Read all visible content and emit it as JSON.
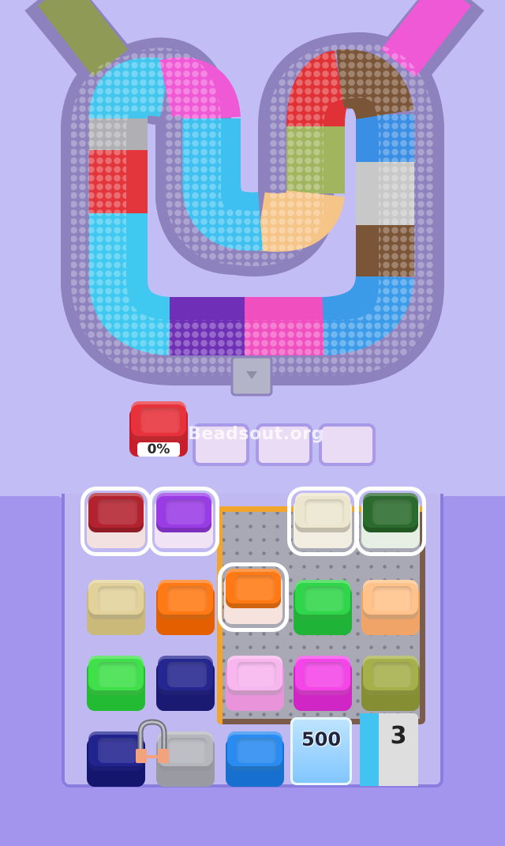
{
  "track": {
    "segment_colors": [
      "#8e9a55",
      "#43c6ee",
      "#ef59d6",
      "#b0b0b4",
      "#e2363c",
      "#3fc8f0",
      "#6f2fb6",
      "#f04fc0",
      "#3b9be9",
      "#7b5538",
      "#c8c8c8",
      "#3a8ee3",
      "#e03236",
      "#a1b45e",
      "#f5c487",
      "#3ec0f0",
      "#ef4fcb",
      "#6a7f3d"
    ],
    "exit_label": ""
  },
  "queue": {
    "slots": [
      {
        "color": "#e8323b",
        "progress": "0%"
      },
      {
        "color": null
      },
      {
        "color": null
      },
      {
        "color": null
      }
    ]
  },
  "watermark": "Beadsout.org",
  "boxes": [
    {
      "id": "red-dark",
      "color": "#b3232f",
      "selected": true
    },
    {
      "id": "purple",
      "color": "#9a3ce6",
      "selected": true
    },
    {
      "id": "cream",
      "color": "#ece6cf",
      "selected": true
    },
    {
      "id": "green-dark",
      "color": "#2b6b2d",
      "selected": true
    },
    {
      "id": "khaki",
      "color": "#e2d29a",
      "selected": false
    },
    {
      "id": "orange",
      "color": "#ff7a14",
      "selected": false
    },
    {
      "id": "orange-selected",
      "color": "#ff7a14",
      "selected": true
    },
    {
      "id": "green",
      "color": "#30d64a",
      "selected": false
    },
    {
      "id": "peach",
      "color": "#ffc28a",
      "selected": false
    },
    {
      "id": "green-light",
      "color": "#3fe04a",
      "selected": false
    },
    {
      "id": "navy",
      "color": "#25268f",
      "selected": false
    },
    {
      "id": "pink-light",
      "color": "#f8b6ee",
      "selected": false
    },
    {
      "id": "magenta",
      "color": "#f446e8",
      "selected": false
    },
    {
      "id": "olive",
      "color": "#a6b04a",
      "selected": false
    },
    {
      "id": "navy-bottom",
      "color": "#21238f",
      "selected": false
    },
    {
      "id": "gray",
      "color": "#b6b6bd",
      "selected": false
    },
    {
      "id": "blue",
      "color": "#2a8bf0",
      "selected": false
    }
  ],
  "ice": {
    "label": "500"
  },
  "counter": {
    "label": "3"
  },
  "icons": {
    "magnet": "magnet-icon"
  }
}
